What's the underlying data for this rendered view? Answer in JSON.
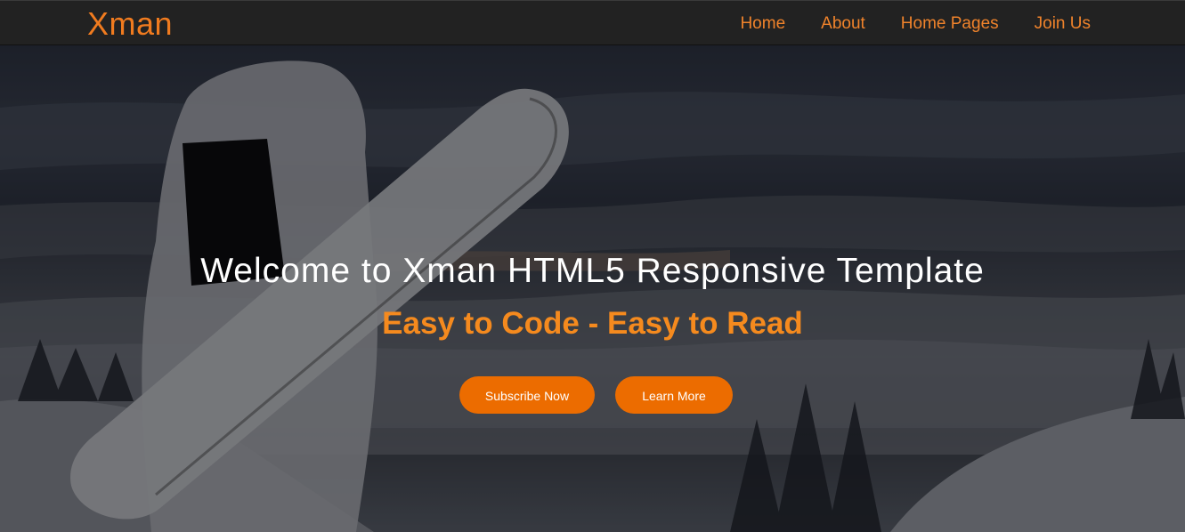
{
  "brand": "Xman",
  "nav": {
    "items": [
      "Home",
      "About",
      "Home Pages",
      "Join Us"
    ]
  },
  "hero": {
    "title": "Welcome to Xman HTML5 Responsive Template",
    "subtitle": "Easy to Code - Easy to Read",
    "buttons": {
      "subscribe": "Subscribe Now",
      "learn_more": "Learn More"
    }
  },
  "colors": {
    "accent": "#ec6c00",
    "brand": "#f07b1f",
    "navbar_bg": "#222222"
  }
}
